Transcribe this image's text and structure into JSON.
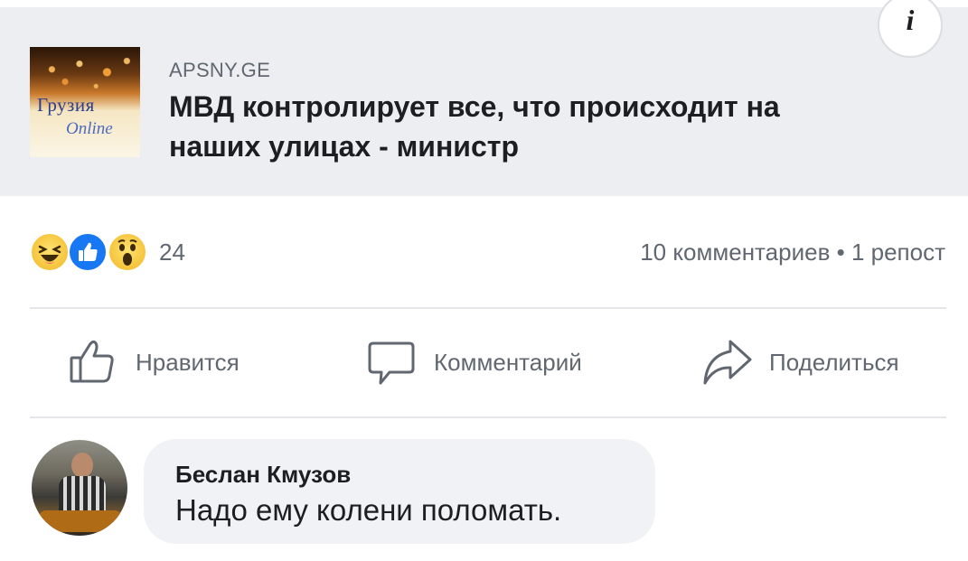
{
  "link_card": {
    "thumbnail_logo_line1": "Грузия",
    "thumbnail_logo_line2": "Online",
    "source": "APSNY.GE",
    "headline": "МВД контролирует все, что происходит на наших улицах - министр",
    "info_icon": "info-icon"
  },
  "stats": {
    "reaction_icons": [
      "haha-reaction-icon",
      "like-reaction-icon",
      "wow-reaction-icon"
    ],
    "reaction_count": "24",
    "comments_shares": "10 комментариев • 1 репост"
  },
  "actions": {
    "like_label": "Нравится",
    "comment_label": "Комментарий",
    "share_label": "Поделиться"
  },
  "comment": {
    "author": "Беслан Кмузов",
    "text": "Надо ему колени поломать."
  },
  "colors": {
    "card_background": "#eceef1",
    "secondary_text": "#606770",
    "like_blue": "#1877f2",
    "reaction_yellow": "#f5c33b",
    "bubble_background": "#f0f2f5"
  }
}
